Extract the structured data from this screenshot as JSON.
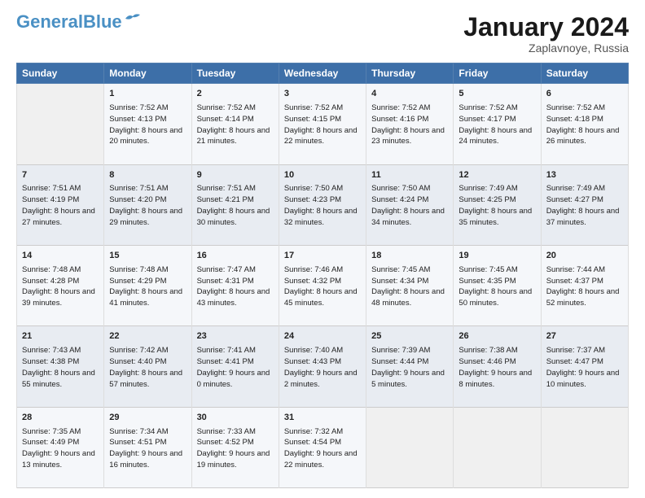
{
  "header": {
    "logo_general": "General",
    "logo_blue": "Blue",
    "month_title": "January 2024",
    "subtitle": "Zaplavnoye, Russia"
  },
  "days_of_week": [
    "Sunday",
    "Monday",
    "Tuesday",
    "Wednesday",
    "Thursday",
    "Friday",
    "Saturday"
  ],
  "weeks": [
    [
      {
        "day": null,
        "sunrise": null,
        "sunset": null,
        "daylight": null
      },
      {
        "day": "1",
        "sunrise": "Sunrise: 7:52 AM",
        "sunset": "Sunset: 4:13 PM",
        "daylight": "Daylight: 8 hours and 20 minutes."
      },
      {
        "day": "2",
        "sunrise": "Sunrise: 7:52 AM",
        "sunset": "Sunset: 4:14 PM",
        "daylight": "Daylight: 8 hours and 21 minutes."
      },
      {
        "day": "3",
        "sunrise": "Sunrise: 7:52 AM",
        "sunset": "Sunset: 4:15 PM",
        "daylight": "Daylight: 8 hours and 22 minutes."
      },
      {
        "day": "4",
        "sunrise": "Sunrise: 7:52 AM",
        "sunset": "Sunset: 4:16 PM",
        "daylight": "Daylight: 8 hours and 23 minutes."
      },
      {
        "day": "5",
        "sunrise": "Sunrise: 7:52 AM",
        "sunset": "Sunset: 4:17 PM",
        "daylight": "Daylight: 8 hours and 24 minutes."
      },
      {
        "day": "6",
        "sunrise": "Sunrise: 7:52 AM",
        "sunset": "Sunset: 4:18 PM",
        "daylight": "Daylight: 8 hours and 26 minutes."
      }
    ],
    [
      {
        "day": "7",
        "sunrise": "Sunrise: 7:51 AM",
        "sunset": "Sunset: 4:19 PM",
        "daylight": "Daylight: 8 hours and 27 minutes."
      },
      {
        "day": "8",
        "sunrise": "Sunrise: 7:51 AM",
        "sunset": "Sunset: 4:20 PM",
        "daylight": "Daylight: 8 hours and 29 minutes."
      },
      {
        "day": "9",
        "sunrise": "Sunrise: 7:51 AM",
        "sunset": "Sunset: 4:21 PM",
        "daylight": "Daylight: 8 hours and 30 minutes."
      },
      {
        "day": "10",
        "sunrise": "Sunrise: 7:50 AM",
        "sunset": "Sunset: 4:23 PM",
        "daylight": "Daylight: 8 hours and 32 minutes."
      },
      {
        "day": "11",
        "sunrise": "Sunrise: 7:50 AM",
        "sunset": "Sunset: 4:24 PM",
        "daylight": "Daylight: 8 hours and 34 minutes."
      },
      {
        "day": "12",
        "sunrise": "Sunrise: 7:49 AM",
        "sunset": "Sunset: 4:25 PM",
        "daylight": "Daylight: 8 hours and 35 minutes."
      },
      {
        "day": "13",
        "sunrise": "Sunrise: 7:49 AM",
        "sunset": "Sunset: 4:27 PM",
        "daylight": "Daylight: 8 hours and 37 minutes."
      }
    ],
    [
      {
        "day": "14",
        "sunrise": "Sunrise: 7:48 AM",
        "sunset": "Sunset: 4:28 PM",
        "daylight": "Daylight: 8 hours and 39 minutes."
      },
      {
        "day": "15",
        "sunrise": "Sunrise: 7:48 AM",
        "sunset": "Sunset: 4:29 PM",
        "daylight": "Daylight: 8 hours and 41 minutes."
      },
      {
        "day": "16",
        "sunrise": "Sunrise: 7:47 AM",
        "sunset": "Sunset: 4:31 PM",
        "daylight": "Daylight: 8 hours and 43 minutes."
      },
      {
        "day": "17",
        "sunrise": "Sunrise: 7:46 AM",
        "sunset": "Sunset: 4:32 PM",
        "daylight": "Daylight: 8 hours and 45 minutes."
      },
      {
        "day": "18",
        "sunrise": "Sunrise: 7:45 AM",
        "sunset": "Sunset: 4:34 PM",
        "daylight": "Daylight: 8 hours and 48 minutes."
      },
      {
        "day": "19",
        "sunrise": "Sunrise: 7:45 AM",
        "sunset": "Sunset: 4:35 PM",
        "daylight": "Daylight: 8 hours and 50 minutes."
      },
      {
        "day": "20",
        "sunrise": "Sunrise: 7:44 AM",
        "sunset": "Sunset: 4:37 PM",
        "daylight": "Daylight: 8 hours and 52 minutes."
      }
    ],
    [
      {
        "day": "21",
        "sunrise": "Sunrise: 7:43 AM",
        "sunset": "Sunset: 4:38 PM",
        "daylight": "Daylight: 8 hours and 55 minutes."
      },
      {
        "day": "22",
        "sunrise": "Sunrise: 7:42 AM",
        "sunset": "Sunset: 4:40 PM",
        "daylight": "Daylight: 8 hours and 57 minutes."
      },
      {
        "day": "23",
        "sunrise": "Sunrise: 7:41 AM",
        "sunset": "Sunset: 4:41 PM",
        "daylight": "Daylight: 9 hours and 0 minutes."
      },
      {
        "day": "24",
        "sunrise": "Sunrise: 7:40 AM",
        "sunset": "Sunset: 4:43 PM",
        "daylight": "Daylight: 9 hours and 2 minutes."
      },
      {
        "day": "25",
        "sunrise": "Sunrise: 7:39 AM",
        "sunset": "Sunset: 4:44 PM",
        "daylight": "Daylight: 9 hours and 5 minutes."
      },
      {
        "day": "26",
        "sunrise": "Sunrise: 7:38 AM",
        "sunset": "Sunset: 4:46 PM",
        "daylight": "Daylight: 9 hours and 8 minutes."
      },
      {
        "day": "27",
        "sunrise": "Sunrise: 7:37 AM",
        "sunset": "Sunset: 4:47 PM",
        "daylight": "Daylight: 9 hours and 10 minutes."
      }
    ],
    [
      {
        "day": "28",
        "sunrise": "Sunrise: 7:35 AM",
        "sunset": "Sunset: 4:49 PM",
        "daylight": "Daylight: 9 hours and 13 minutes."
      },
      {
        "day": "29",
        "sunrise": "Sunrise: 7:34 AM",
        "sunset": "Sunset: 4:51 PM",
        "daylight": "Daylight: 9 hours and 16 minutes."
      },
      {
        "day": "30",
        "sunrise": "Sunrise: 7:33 AM",
        "sunset": "Sunset: 4:52 PM",
        "daylight": "Daylight: 9 hours and 19 minutes."
      },
      {
        "day": "31",
        "sunrise": "Sunrise: 7:32 AM",
        "sunset": "Sunset: 4:54 PM",
        "daylight": "Daylight: 9 hours and 22 minutes."
      },
      {
        "day": null,
        "sunrise": null,
        "sunset": null,
        "daylight": null
      },
      {
        "day": null,
        "sunrise": null,
        "sunset": null,
        "daylight": null
      },
      {
        "day": null,
        "sunrise": null,
        "sunset": null,
        "daylight": null
      }
    ]
  ]
}
